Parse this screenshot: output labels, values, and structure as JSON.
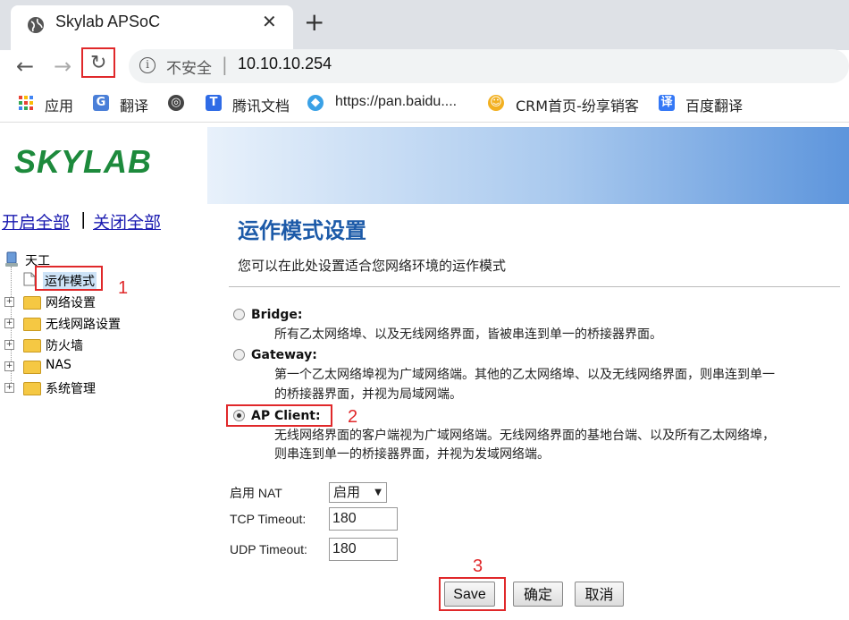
{
  "browser": {
    "tab_title": "Skylab APSoC",
    "tab_close": "✕",
    "new_tab": "+",
    "insecure_label": "不安全",
    "url_separator": "|",
    "url": "10.10.10.254"
  },
  "bookmarks": [
    {
      "label": "应用",
      "icon": "apps-grid-icon",
      "color": "#e94235"
    },
    {
      "label": "翻译",
      "icon": "translate-icon",
      "color": "#4a7fd8"
    },
    {
      "label": "",
      "icon": "globe-icon",
      "color": "#444444"
    },
    {
      "label": "腾讯文档",
      "icon": "tencent-docs-icon",
      "color": "#2f6be6"
    },
    {
      "label": "https://pan.baidu....",
      "icon": "baidu-pan-icon",
      "color": "#3aa1e6"
    },
    {
      "label": "CRM首页-纷享销客",
      "icon": "crm-icon",
      "color": "#f2b021"
    },
    {
      "label": "百度翻译",
      "icon": "baidu-translate-icon",
      "color": "#3478f6"
    }
  ],
  "sidebar": {
    "logo": "SKYLAB",
    "open_all": "开启全部",
    "separator": "|",
    "close_all": "关闭全部",
    "root": "天工",
    "selected": "运作模式",
    "folders": [
      "网络设置",
      "无线网路设置",
      "防火墙",
      "NAS",
      "系统管理"
    ]
  },
  "main": {
    "title": "运作模式设置",
    "description": "您可以在此处设置适合您网络环境的运作模式",
    "options": [
      {
        "title": "Bridge:",
        "desc": [
          "所有乙太网络埠、以及无线网络界面，皆被串连到单一的桥接器界面。"
        ],
        "selected": false
      },
      {
        "title": "Gateway:",
        "desc": [
          "第一个乙太网络埠视为广域网络端。其他的乙太网络埠、以及无线网络界面，则串连到单一",
          "的桥接器界面，并视为局域网端。"
        ],
        "selected": false
      },
      {
        "title": "AP Client:",
        "desc": [
          "无线网络界面的客户端视为广域网络端。无线网络界面的基地台端、以及所有乙太网络埠，",
          "则串连到单一的桥接器界面，并视为发域网络端。"
        ],
        "selected": true
      }
    ],
    "nat_label": "启用 NAT",
    "nat_value": "启用",
    "tcp_label": "TCP Timeout:",
    "tcp_value": "180",
    "udp_label": "UDP Timeout:",
    "udp_value": "180",
    "save_label": "Save",
    "confirm_label": "确定",
    "cancel_label": "取消"
  },
  "annotations": [
    "1",
    "2",
    "3"
  ],
  "colors": {
    "annotation": "#e0282a",
    "title": "#1c5aa8",
    "logo": "#1d8a3c"
  }
}
